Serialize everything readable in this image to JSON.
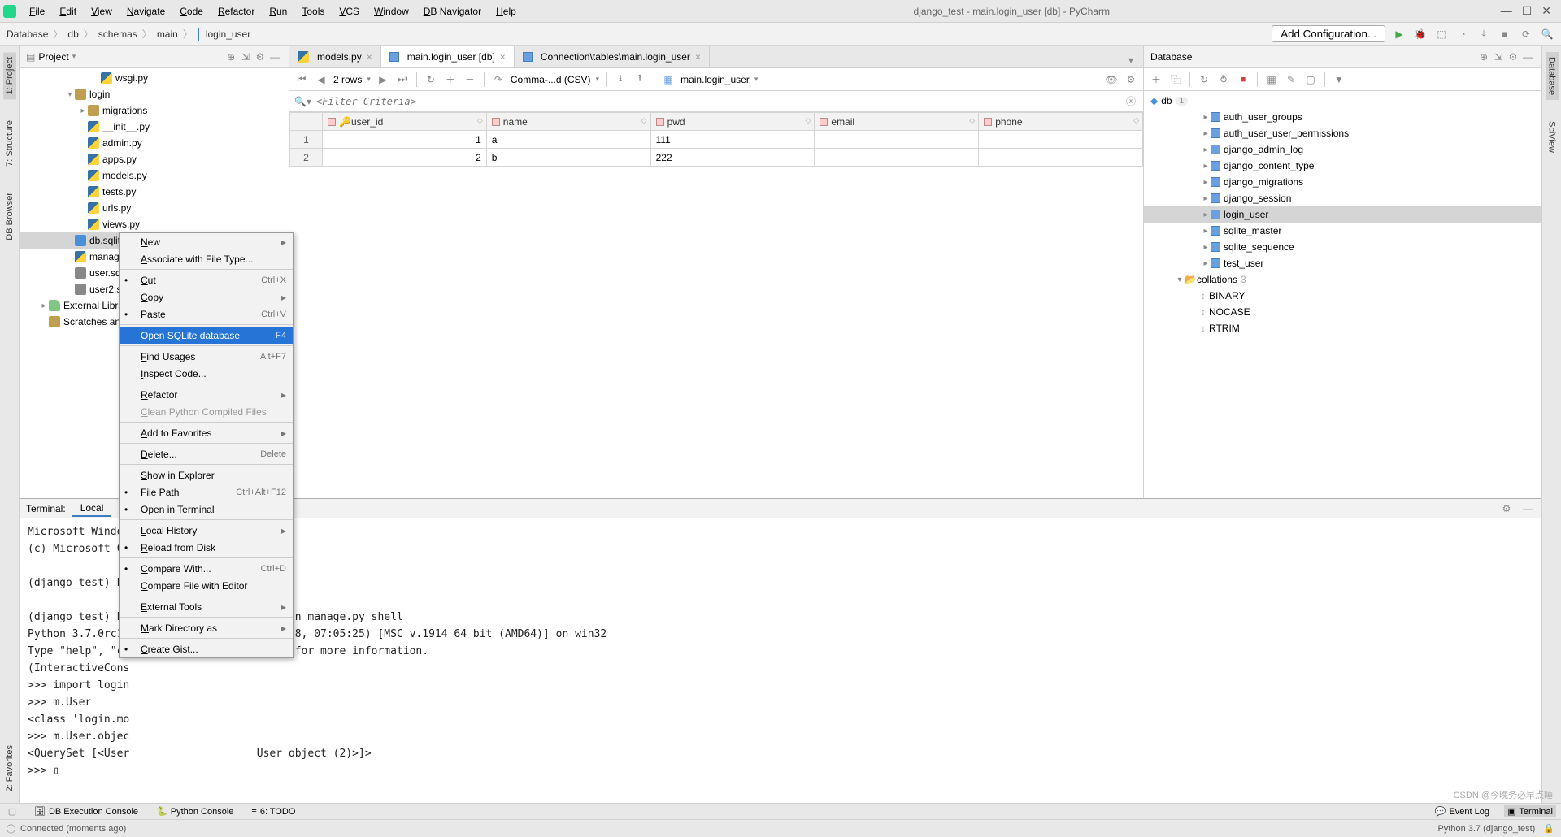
{
  "window": {
    "title": "django_test - main.login_user [db] - PyCharm"
  },
  "menu": [
    "File",
    "Edit",
    "View",
    "Navigate",
    "Code",
    "Refactor",
    "Run",
    "Tools",
    "VCS",
    "Window",
    "DB Navigator",
    "Help"
  ],
  "breadcrumb": [
    "Database",
    "db",
    "schemas",
    "main",
    "login_user"
  ],
  "add_config": "Add Configuration...",
  "left_tabs": [
    "1: Project",
    "7: Structure",
    "DB Browser",
    "2: Favorites"
  ],
  "right_tabs": [
    "Database",
    "SciView"
  ],
  "project_panel": {
    "title": "Project"
  },
  "project_tree": [
    {
      "indent": 5,
      "icon": "py",
      "label": "wsgi.py"
    },
    {
      "indent": 3,
      "icon": "folder",
      "label": "login",
      "arrow": "▾"
    },
    {
      "indent": 4,
      "icon": "folder",
      "label": "migrations",
      "arrow": "▸"
    },
    {
      "indent": 4,
      "icon": "py",
      "label": "__init__.py"
    },
    {
      "indent": 4,
      "icon": "py",
      "label": "admin.py"
    },
    {
      "indent": 4,
      "icon": "py",
      "label": "apps.py"
    },
    {
      "indent": 4,
      "icon": "py",
      "label": "models.py"
    },
    {
      "indent": 4,
      "icon": "py",
      "label": "tests.py"
    },
    {
      "indent": 4,
      "icon": "py",
      "label": "urls.py"
    },
    {
      "indent": 4,
      "icon": "py",
      "label": "views.py"
    },
    {
      "indent": 3,
      "icon": "db",
      "label": "db.sqlite3",
      "selected": true
    },
    {
      "indent": 3,
      "icon": "py",
      "label": "manage.py"
    },
    {
      "indent": 3,
      "icon": "sql",
      "label": "user.sql"
    },
    {
      "indent": 3,
      "icon": "sql",
      "label": "user2.sql"
    },
    {
      "indent": 1,
      "icon": "lib",
      "label": "External Libraries",
      "arrow": "▸"
    },
    {
      "indent": 1,
      "icon": "folder",
      "label": "Scratches and Consoles"
    }
  ],
  "editor_tabs": [
    {
      "label": "models.py",
      "icon": "py"
    },
    {
      "label": "main.login_user [db]",
      "icon": "tbl",
      "active": true
    },
    {
      "label": "Connection\\tables\\main.login_user",
      "icon": "tbl"
    }
  ],
  "db_toolbar": {
    "rows_text": "2 rows",
    "format": "Comma-...d (CSV)",
    "table_name": "main.login_user"
  },
  "filter_placeholder": "<Filter Criteria>",
  "grid": {
    "columns": [
      "user_id",
      "name",
      "pwd",
      "email",
      "phone"
    ],
    "rows": [
      {
        "num": "1",
        "user_id": "1",
        "name": "a",
        "pwd": "111",
        "email": "<null>",
        "phone": "<null>"
      },
      {
        "num": "2",
        "user_id": "2",
        "name": "b",
        "pwd": "222",
        "email": "<null>",
        "phone": "<null>"
      }
    ]
  },
  "database_panel": {
    "title": "Database"
  },
  "db_source": {
    "name": "db",
    "badge": "1"
  },
  "db_tables": [
    "auth_user_groups",
    "auth_user_user_permissions",
    "django_admin_log",
    "django_content_type",
    "django_migrations",
    "django_session",
    "login_user",
    "sqlite_master",
    "sqlite_sequence",
    "test_user"
  ],
  "db_collations": {
    "label": "collations",
    "count": "3",
    "items": [
      "BINARY",
      "NOCASE",
      "RTRIM"
    ]
  },
  "terminal": {
    "title": "Terminal:",
    "tab": "Local",
    "lines": [
      "Microsoft Windows",
      "(c) Microsoft Co",
      "",
      "(django_test) E:                    pro",
      "",
      "(django_test) E:                    >python manage.py shell",
      "Python 3.7.0rc1                     12 2018, 07:05:25) [MSC v.1914 64 bit (AMD64)] on win32",
      "Type \"help\", \"co                    ense\" for more information.",
      "(InteractiveCons",
      ">>> import login",
      ">>> m.User",
      "<class 'login.mo",
      ">>> m.User.objec",
      "<QuerySet [<User                    User object (2)>]>",
      ">>> ▯"
    ]
  },
  "context_menu": [
    {
      "type": "item",
      "label": "New",
      "sub": true
    },
    {
      "type": "item",
      "label": "Associate with File Type..."
    },
    {
      "type": "sep"
    },
    {
      "type": "item",
      "label": "Cut",
      "shortcut": "Ctrl+X",
      "icon": "cut"
    },
    {
      "type": "item",
      "label": "Copy",
      "sub": true
    },
    {
      "type": "item",
      "label": "Paste",
      "shortcut": "Ctrl+V",
      "icon": "paste"
    },
    {
      "type": "sep"
    },
    {
      "type": "item",
      "label": "Open SQLite database",
      "shortcut": "F4",
      "highlight": true
    },
    {
      "type": "sep"
    },
    {
      "type": "item",
      "label": "Find Usages",
      "shortcut": "Alt+F7"
    },
    {
      "type": "item",
      "label": "Inspect Code..."
    },
    {
      "type": "sep"
    },
    {
      "type": "item",
      "label": "Refactor",
      "sub": true
    },
    {
      "type": "item",
      "label": "Clean Python Compiled Files",
      "disabled": true
    },
    {
      "type": "sep"
    },
    {
      "type": "item",
      "label": "Add to Favorites",
      "sub": true
    },
    {
      "type": "sep"
    },
    {
      "type": "item",
      "label": "Delete...",
      "shortcut": "Delete"
    },
    {
      "type": "sep"
    },
    {
      "type": "item",
      "label": "Show in Explorer"
    },
    {
      "type": "item",
      "label": "File Path",
      "shortcut": "Ctrl+Alt+F12",
      "icon": "path"
    },
    {
      "type": "item",
      "label": "Open in Terminal",
      "icon": "term"
    },
    {
      "type": "sep"
    },
    {
      "type": "item",
      "label": "Local History",
      "sub": true
    },
    {
      "type": "item",
      "label": "Reload from Disk",
      "icon": "reload"
    },
    {
      "type": "sep"
    },
    {
      "type": "item",
      "label": "Compare With...",
      "shortcut": "Ctrl+D",
      "icon": "diff"
    },
    {
      "type": "item",
      "label": "Compare File with Editor"
    },
    {
      "type": "sep"
    },
    {
      "type": "item",
      "label": "External Tools",
      "sub": true
    },
    {
      "type": "sep"
    },
    {
      "type": "item",
      "label": "Mark Directory as",
      "sub": true
    },
    {
      "type": "sep"
    },
    {
      "type": "item",
      "label": "Create Gist...",
      "icon": "gh"
    }
  ],
  "bottom_tabs": [
    {
      "label": "DB Execution Console",
      "icon": "🗄"
    },
    {
      "label": "Python Console",
      "icon": "🐍"
    },
    {
      "label": "6: TODO",
      "icon": "≡"
    }
  ],
  "bottom_right": [
    {
      "label": "Event Log",
      "icon": "💬"
    },
    {
      "label": "Terminal",
      "icon": "▣",
      "active": true
    }
  ],
  "status": {
    "left": "Connected (moments ago)",
    "right": "Python 3.7 (django_test)",
    "watermark": "CSDN @今晚务必早点睡"
  }
}
